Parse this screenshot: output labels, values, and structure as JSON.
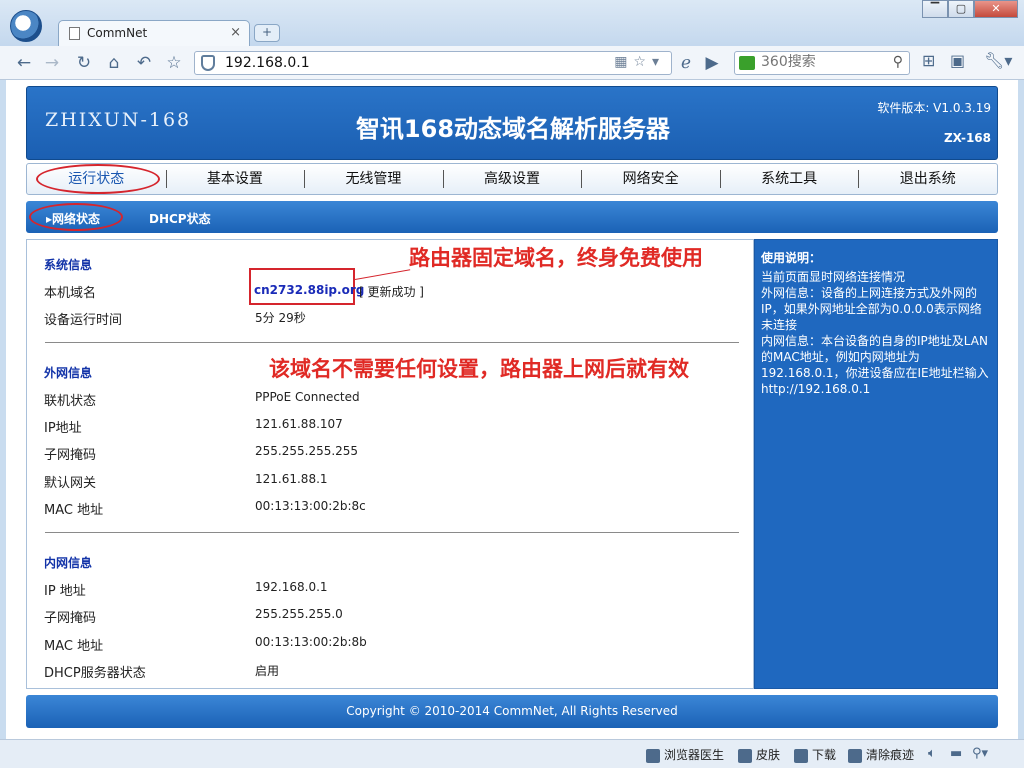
{
  "browser": {
    "tab_title": "CommNet",
    "address": "192.168.0.1",
    "search_placeholder": "360搜索",
    "window_buttons": [
      "▔",
      "▢",
      "✕"
    ]
  },
  "header": {
    "brand": "ZHIXUN-168",
    "title": "智讯168动态域名解析服务器",
    "version": "软件版本: V1.0.3.19",
    "model": "ZX-168"
  },
  "menu": [
    "运行状态",
    "基本设置",
    "无线管理",
    "高级设置",
    "网络安全",
    "系统工具",
    "退出系统"
  ],
  "submenu": {
    "network_status": "网络状态",
    "dhcp_status": "DHCP状态"
  },
  "system_info": {
    "title": "系统信息",
    "hostname_label": "本机域名",
    "hostname_value": "cn2732.88ip.org",
    "update_status": "[ 更新成功 ]",
    "uptime_label": "设备运行时间",
    "uptime_value": "5分 29秒"
  },
  "wan_info": {
    "title": "外网信息",
    "rows": [
      {
        "label": "联机状态",
        "value": "PPPoE Connected"
      },
      {
        "label": "IP地址",
        "value": "121.61.88.107"
      },
      {
        "label": "子网掩码",
        "value": "255.255.255.255"
      },
      {
        "label": "默认网关",
        "value": "121.61.88.1"
      },
      {
        "label": "MAC 地址",
        "value": "00:13:13:00:2b:8c"
      }
    ]
  },
  "lan_info": {
    "title": "内网信息",
    "rows": [
      {
        "label": "IP 地址",
        "value": "192.168.0.1"
      },
      {
        "label": "子网掩码",
        "value": "255.255.255.0"
      },
      {
        "label": "MAC 地址",
        "value": "00:13:13:00:2b:8b"
      },
      {
        "label": "DHCP服务器状态",
        "value": "启用"
      }
    ]
  },
  "annotations": {
    "promo_1": "路由器固定域名，终身免费使用",
    "promo_2": "该域名不需要任何设置，路由器上网后就有效"
  },
  "sidebar": {
    "title": "使用说明：",
    "body": "当前页面显时网络连接情况\n外网信息：设备的上网连接方式及外网的IP，如果外网地址全部为0.0.0.0表示网络未连接\n内网信息：本台设备的自身的IP地址及LAN的MAC地址，例如内网地址为192.168.0.1，你进设备应在IE地址栏输入http://192.168.0.1"
  },
  "footer": "Copyright © 2010-2014 CommNet, All Rights Reserved",
  "statusbar": {
    "doctor": "浏览器医生",
    "skin": "皮肤",
    "download": "下载",
    "clear": "清除痕迹"
  },
  "colors": {
    "header_blue": "#1b5fb2",
    "highlight_red": "#d5252d",
    "link_blue": "#1a2bb8",
    "section_blue": "#1233a8"
  }
}
